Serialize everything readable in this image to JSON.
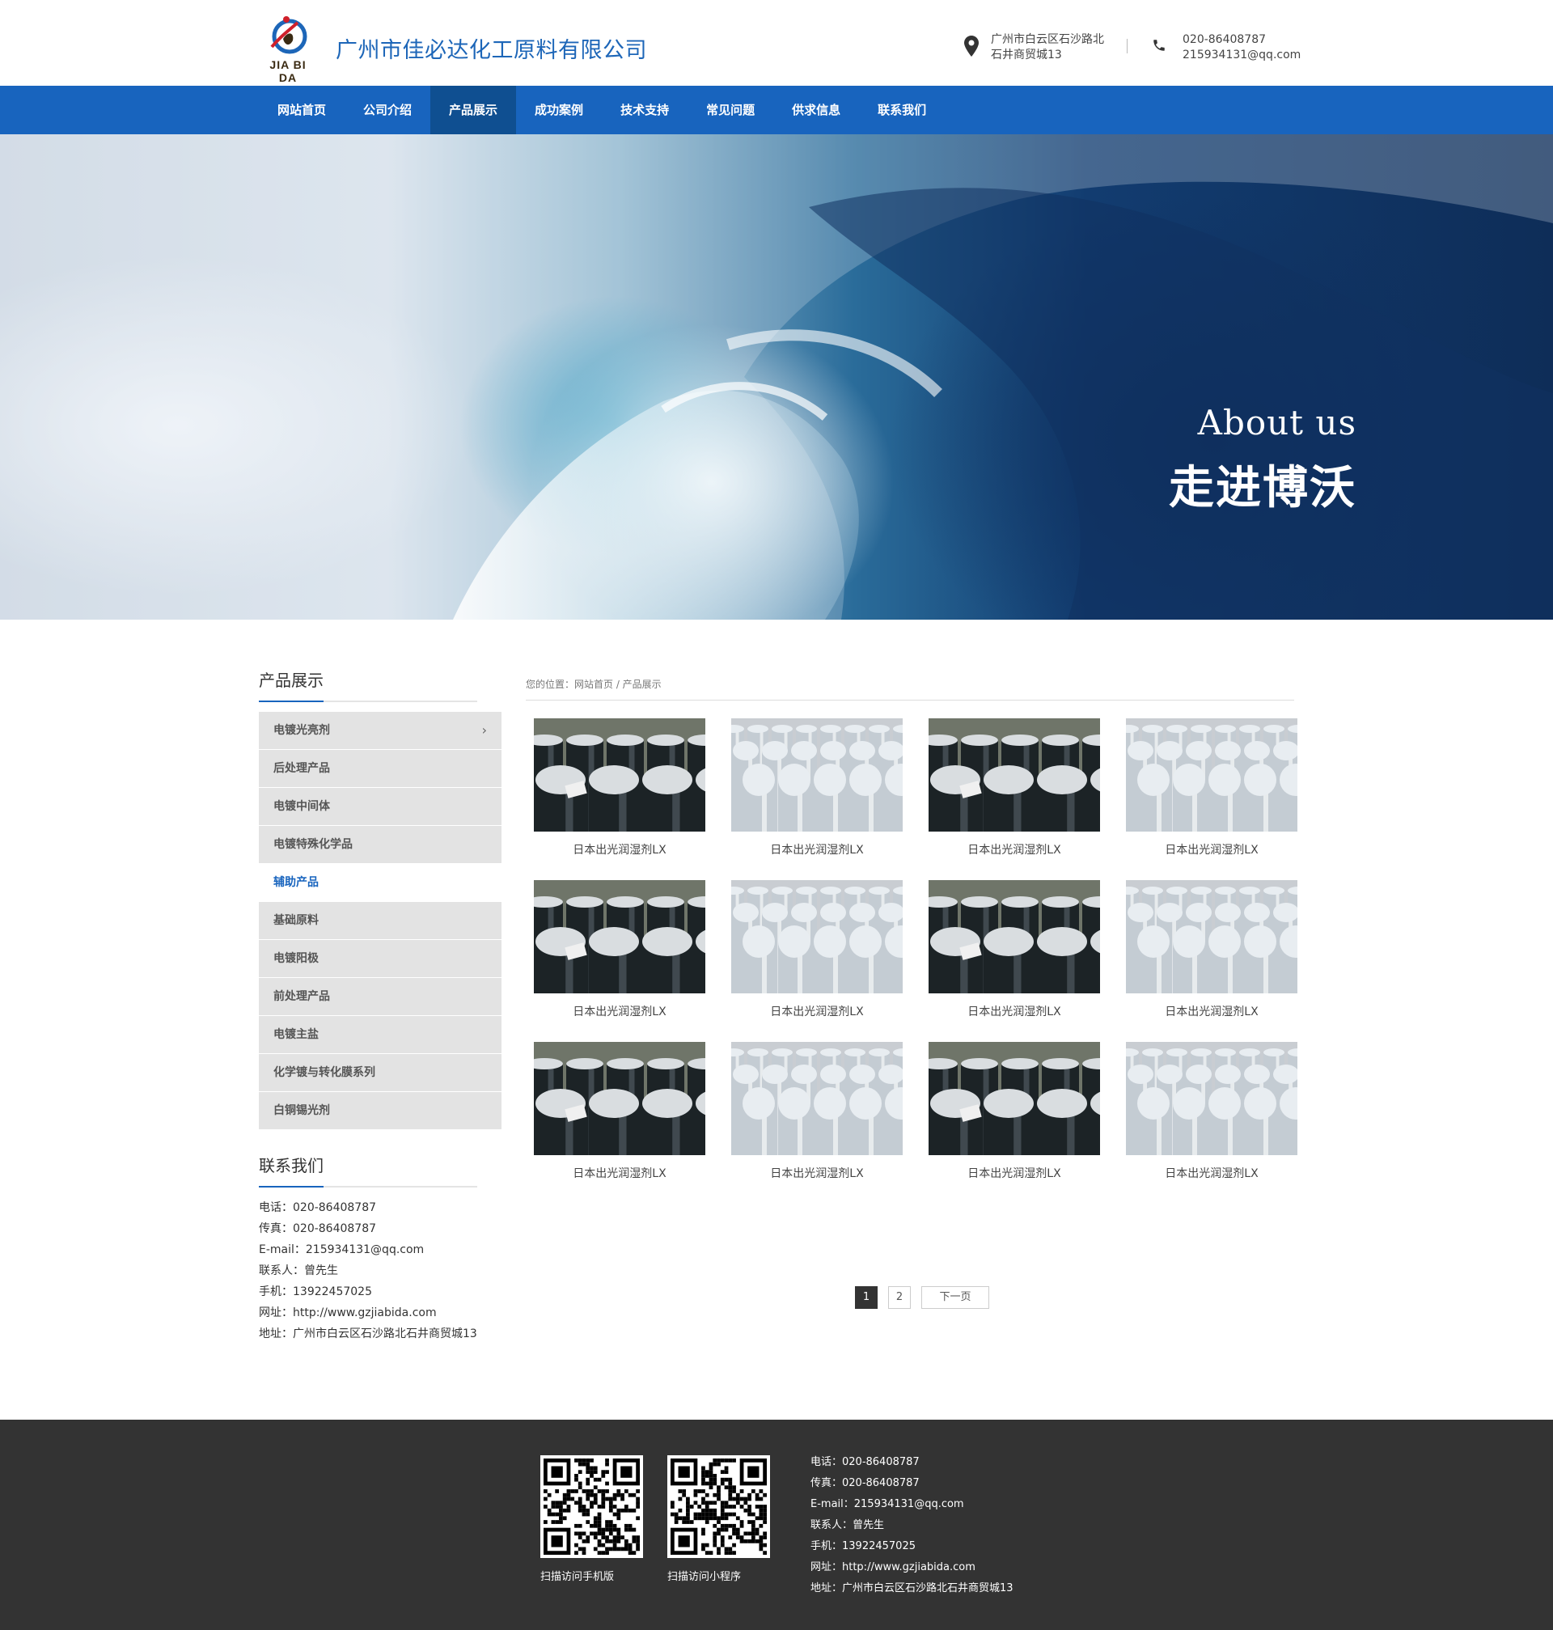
{
  "header": {
    "logo_text": "JIA BI DA",
    "company_name": "广州市佳必达化工原料有限公司",
    "address_line1": "广州市白云区石沙路北",
    "address_line2": "石井商贸城13",
    "phone": "020-86408787",
    "email": "215934131@qq.com"
  },
  "nav": {
    "items": [
      {
        "label": "网站首页"
      },
      {
        "label": "公司介绍"
      },
      {
        "label": "产品展示"
      },
      {
        "label": "成功案例"
      },
      {
        "label": "技术支持"
      },
      {
        "label": "常见问题"
      },
      {
        "label": "供求信息"
      },
      {
        "label": "联系我们"
      }
    ],
    "active": "产品展示"
  },
  "banner": {
    "title_en": "About us",
    "title_cn": "走进博沃"
  },
  "sidebar": {
    "title": "产品展示",
    "categories": [
      {
        "label": "电镀光亮剂"
      },
      {
        "label": "后处理产品"
      },
      {
        "label": "电镀中间体"
      },
      {
        "label": "电镀特殊化学品"
      },
      {
        "label": "辅助产品"
      },
      {
        "label": "基础原料"
      },
      {
        "label": "电镀阳极"
      },
      {
        "label": "前处理产品"
      },
      {
        "label": "电镀主盐"
      },
      {
        "label": "化学镀与转化膜系列"
      },
      {
        "label": "白铜锡光剂"
      }
    ],
    "active_category": "辅助产品",
    "contact_title": "联系我们",
    "contact": {
      "tel": "电话：020-86408787",
      "fax": "传真：020-86408787",
      "email": "E-mail：215934131@qq.com",
      "person": "联系人：曾先生",
      "mobile": "手机：13922457025",
      "site": "网址：http://www.gzjiabida.com",
      "address": "地址：广州市白云区石沙路北石井商贸城13"
    }
  },
  "content": {
    "breadcrumb": "您的位置：网站首页 /  产品展示",
    "products": [
      {
        "name": "日本出光润湿剂LX",
        "image": "dark-drums"
      },
      {
        "name": "日本出光润湿剂LX",
        "image": "silver-drums"
      },
      {
        "name": "日本出光润湿剂LX",
        "image": "dark-drums"
      },
      {
        "name": "日本出光润湿剂LX",
        "image": "silver-drums"
      },
      {
        "name": "日本出光润湿剂LX",
        "image": "dark-drums"
      },
      {
        "name": "日本出光润湿剂LX",
        "image": "silver-drums"
      },
      {
        "name": "日本出光润湿剂LX",
        "image": "dark-drums"
      },
      {
        "name": "日本出光润湿剂LX",
        "image": "silver-drums"
      },
      {
        "name": "日本出光润湿剂LX",
        "image": "dark-drums"
      },
      {
        "name": "日本出光润湿剂LX",
        "image": "silver-drums"
      },
      {
        "name": "日本出光润湿剂LX",
        "image": "dark-drums"
      },
      {
        "name": "日本出光润湿剂LX",
        "image": "silver-drums"
      }
    ],
    "pagination": {
      "pages": [
        "1",
        "2"
      ],
      "current": "1",
      "next_label": "下一页"
    }
  },
  "footer": {
    "qr_mobile_caption": "扫描访问手机版",
    "qr_miniprogram_caption": "扫描访问小程序",
    "contact": {
      "tel": "电话：020-86408787",
      "fax": "传真：020-86408787",
      "email": "E-mail：215934131@qq.com",
      "person": "联系人：曾先生",
      "mobile": "手机：13922457025",
      "site": "网址：http://www.gzjiabida.com",
      "address": "地址：广州市白云区石沙路北石井商贸城13"
    }
  },
  "colors": {
    "brand_blue": "#1864be",
    "nav_active": "#0f4f91",
    "footer_bg": "#333333"
  }
}
